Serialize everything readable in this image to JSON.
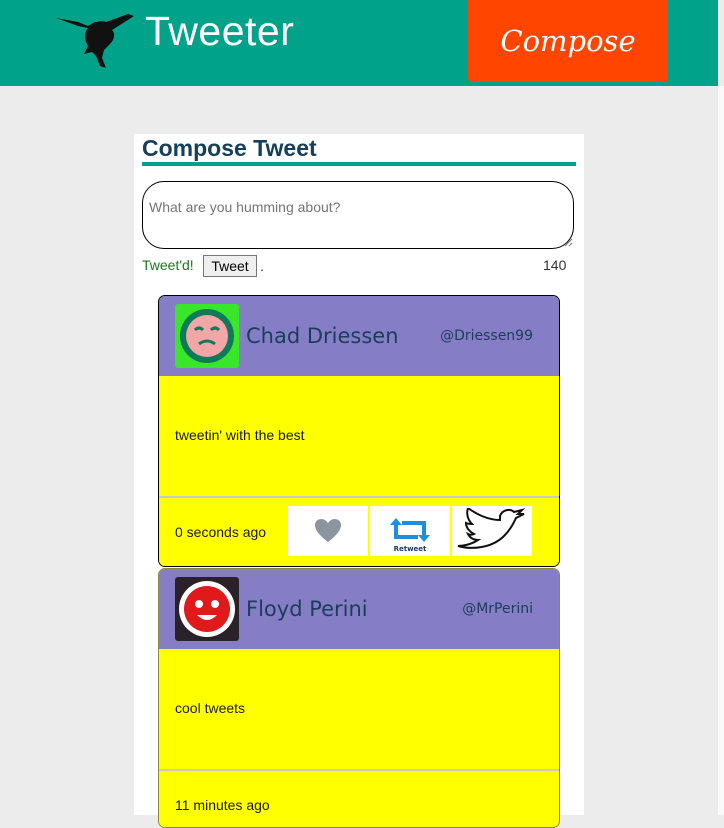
{
  "header": {
    "brand": "Tweeter",
    "compose_label": "Compose",
    "logo_icon": "hummingbird-icon",
    "color": "#00a389",
    "compose_color": "#ff4500"
  },
  "compose": {
    "title": "Compose Tweet",
    "placeholder": "What are you humming about?",
    "status": "Tweet'd!",
    "button_label": "Tweet",
    "separator": ".",
    "counter": "140"
  },
  "tweets": [
    {
      "name": "Chad Driessen",
      "handle": "@Driessen99",
      "content": "tweetin' with the best",
      "time": "0 seconds ago",
      "avatar_icon": "green-face-avatar",
      "actions": [
        {
          "icon": "heart-icon"
        },
        {
          "icon": "retweet-icon",
          "label": "Retweet"
        },
        {
          "icon": "twitter-bird-icon"
        }
      ]
    },
    {
      "name": "Floyd Perini",
      "handle": "@MrPerini",
      "content": "cool tweets",
      "time": "11 minutes ago",
      "avatar_icon": "red-face-avatar"
    }
  ],
  "colors": {
    "card_header": "#857dc6",
    "card_body": "#ffff00",
    "text_dark": "#1c3d5a"
  }
}
